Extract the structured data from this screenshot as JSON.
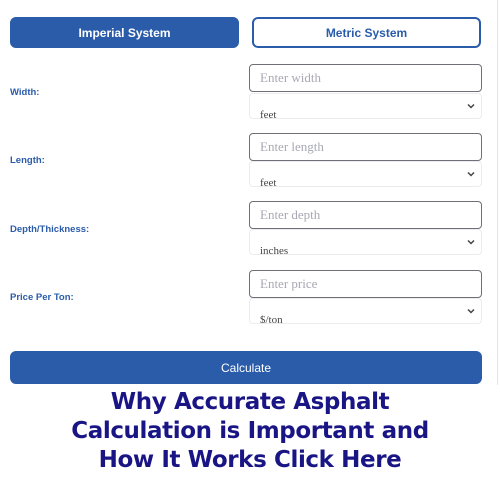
{
  "system_toggle": {
    "imperial_label": "Imperial System",
    "metric_label": "Metric System",
    "selected": "Imperial System"
  },
  "fields": [
    {
      "label": "Width:",
      "placeholder": "Enter width",
      "value": "",
      "unit": "feet"
    },
    {
      "label": "Length:",
      "placeholder": "Enter length",
      "value": "",
      "unit": "feet"
    },
    {
      "label": "Depth/Thickness:",
      "placeholder": "Enter depth",
      "value": "",
      "unit": "inches"
    },
    {
      "label": "Price Per Ton:",
      "placeholder": "Enter price",
      "value": "",
      "unit": "$/ton"
    }
  ],
  "calculate_label": "Calculate",
  "cta": {
    "lines": [
      "Why Accurate Asphalt",
      "Calculation is Important and",
      "How It Works Click Here"
    ]
  },
  "colors": {
    "primary": "#2a5caa",
    "cta_text": "#1a1585",
    "label": "#2a5caa"
  }
}
